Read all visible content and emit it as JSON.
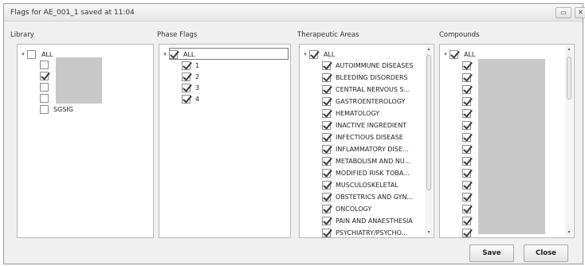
{
  "window": {
    "title": "Flags for AE_001_1 saved at 11:04",
    "restore_glyph": "▭",
    "close_glyph": "✕"
  },
  "columns": {
    "library": {
      "header": "Library",
      "root_label": "ALL",
      "root_checked": false,
      "items": [
        {
          "label": "",
          "checked": false
        },
        {
          "label": "",
          "checked": true
        },
        {
          "label": "",
          "checked": false
        },
        {
          "label": "",
          "checked": false
        },
        {
          "label": "SGSIG",
          "checked": false
        }
      ]
    },
    "phase_flags": {
      "header": "Phase Flags",
      "root_label": "ALL",
      "root_checked": true,
      "items": [
        {
          "label": "1",
          "checked": true
        },
        {
          "label": "2",
          "checked": true
        },
        {
          "label": "3",
          "checked": true
        },
        {
          "label": "4",
          "checked": true
        }
      ]
    },
    "therapeutic_areas": {
      "header": "Therapeutic Areas",
      "root_label": "ALL",
      "root_checked": true,
      "items": [
        {
          "label": "AUTOIMMUNE DISEASES",
          "checked": true
        },
        {
          "label": "BLEEDING DISORDERS",
          "checked": true
        },
        {
          "label": "CENTRAL NERVOUS S...",
          "checked": true
        },
        {
          "label": "GASTROENTEROLOGY",
          "checked": true
        },
        {
          "label": "HEMATOLOGY",
          "checked": true
        },
        {
          "label": "INACTIVE INGREDIENT",
          "checked": true
        },
        {
          "label": "INFECTIOUS DISEASE",
          "checked": true
        },
        {
          "label": "INFLAMMATORY DISE...",
          "checked": true
        },
        {
          "label": "METABOLISM AND NU...",
          "checked": true
        },
        {
          "label": "MODIFIED RISK TOBA...",
          "checked": true
        },
        {
          "label": "MUSCULOSKELETAL",
          "checked": true
        },
        {
          "label": "OBSTETRICS AND GYN...",
          "checked": true
        },
        {
          "label": "ONCOLOGY",
          "checked": true
        },
        {
          "label": "PAIN AND ANAESTHESIA",
          "checked": true
        },
        {
          "label": "PSYCHIATRY/PSYCHO...",
          "checked": true
        }
      ]
    },
    "compounds": {
      "header": "Compounds",
      "root_label": "ALL",
      "root_checked": true,
      "item_count": 15
    }
  },
  "buttons": {
    "save": "Save",
    "close": "Close"
  },
  "icons": {
    "expander": "▾",
    "scroll_up": "▴",
    "scroll_down": "▾"
  },
  "colors": {
    "panel_bg": "#ffffff",
    "dialog_bg": "#f0f0f0",
    "redaction": "#c8c8c8"
  }
}
